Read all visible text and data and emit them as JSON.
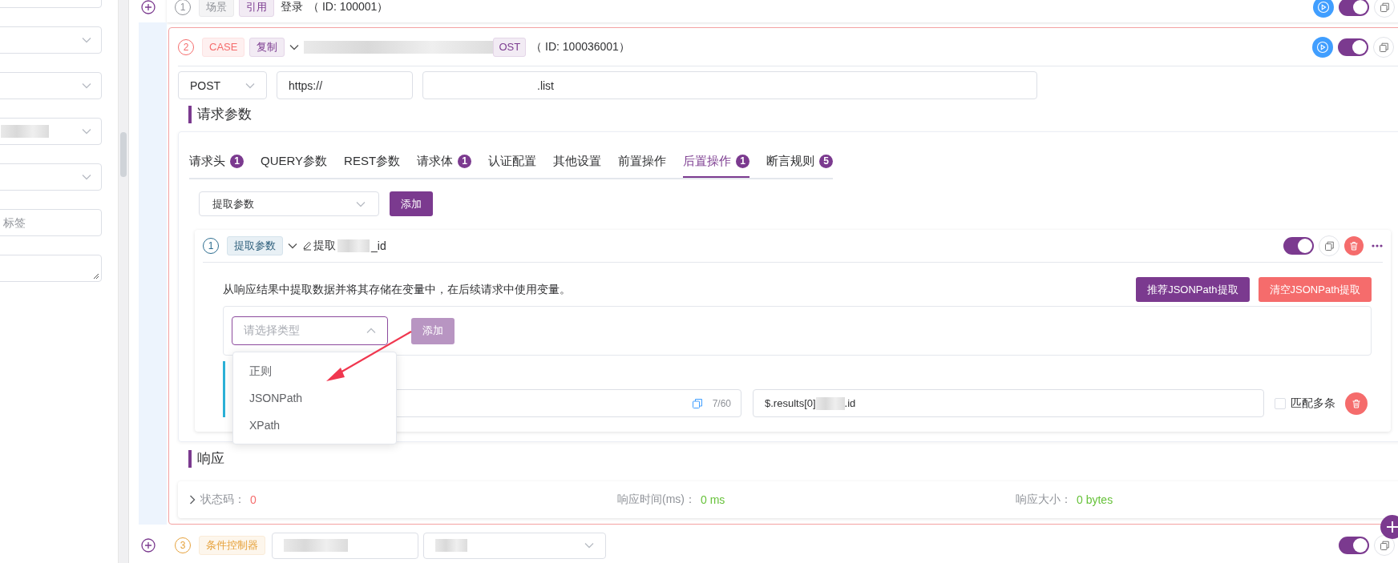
{
  "sidebar": {
    "fields": [
      {
        "kind": "input"
      },
      {
        "kind": "select"
      },
      {
        "kind": "select"
      },
      {
        "kind": "select",
        "redacted": true
      },
      {
        "kind": "select"
      },
      {
        "kind": "input",
        "placeholder": "标签"
      },
      {
        "kind": "textarea"
      }
    ]
  },
  "step_1": {
    "number": "1",
    "tags": [
      {
        "label": "场景",
        "kind": "scene"
      },
      {
        "label": "引用",
        "kind": "ref"
      }
    ],
    "name": "登录",
    "id_label": "（ ID: 100001）",
    "enabled": true
  },
  "case_step": {
    "number": "2",
    "tags": [
      {
        "label": "CASE",
        "kind": "case"
      },
      {
        "label": "复制",
        "kind": "copy"
      }
    ],
    "method_tag": "OST",
    "id_label": "（ ID: 100036001）",
    "enabled": true,
    "request": {
      "method": "POST",
      "url_start": "https://",
      "url_end": ".list"
    },
    "params_heading": "请求参数",
    "tabs": [
      {
        "label": "请求头",
        "count": "1",
        "selected": false
      },
      {
        "label": "QUERY参数",
        "selected": false
      },
      {
        "label": "REST参数",
        "selected": false
      },
      {
        "label": "请求体",
        "count": "1",
        "selected": false
      },
      {
        "label": "认证配置",
        "selected": false
      },
      {
        "label": "其他设置",
        "selected": false
      },
      {
        "label": "前置操作",
        "selected": false
      },
      {
        "label": "后置操作",
        "count": "1",
        "selected": true
      },
      {
        "label": "断言规则",
        "count": "5",
        "selected": false
      }
    ],
    "post_ops": {
      "type_select": "提取参数",
      "add_button": "添加",
      "item": {
        "number": "1",
        "tag": "提取参数",
        "name_start": "提取",
        "name_end": "_id",
        "enabled": true,
        "description": "从响应结果中提取数据并将其存储在变量中，在后续请求中使用变量。",
        "buttons": [
          {
            "label": "推荐JSONPath提取",
            "kind": "primary"
          },
          {
            "label": "清空JSONPath提取",
            "kind": "danger"
          }
        ],
        "type_placeholder": "请选择类型",
        "add_button": "添加",
        "add_disabled": true,
        "dropdown": {
          "open": true,
          "options": [
            "正则",
            "JSONPath",
            "XPath"
          ]
        },
        "rule": {
          "counter": "7/60",
          "expression_start": "$.results[0]",
          "expression_end": ".id",
          "match_all_label": "匹配多条",
          "match_all": false
        }
      }
    },
    "response_heading": "响应",
    "response": {
      "expanded": false,
      "fields": [
        {
          "label": "状态码：",
          "value": "0",
          "kind": "error"
        },
        {
          "label": "响应时间(ms)：",
          "value": "0 ms",
          "kind": "ok"
        },
        {
          "label": "响应大小：",
          "value": "0 bytes",
          "kind": "ok"
        }
      ]
    }
  },
  "step_3": {
    "number": "3",
    "tags": [
      {
        "label": "条件控制器",
        "kind": "condition"
      }
    ],
    "enabled": true
  }
}
